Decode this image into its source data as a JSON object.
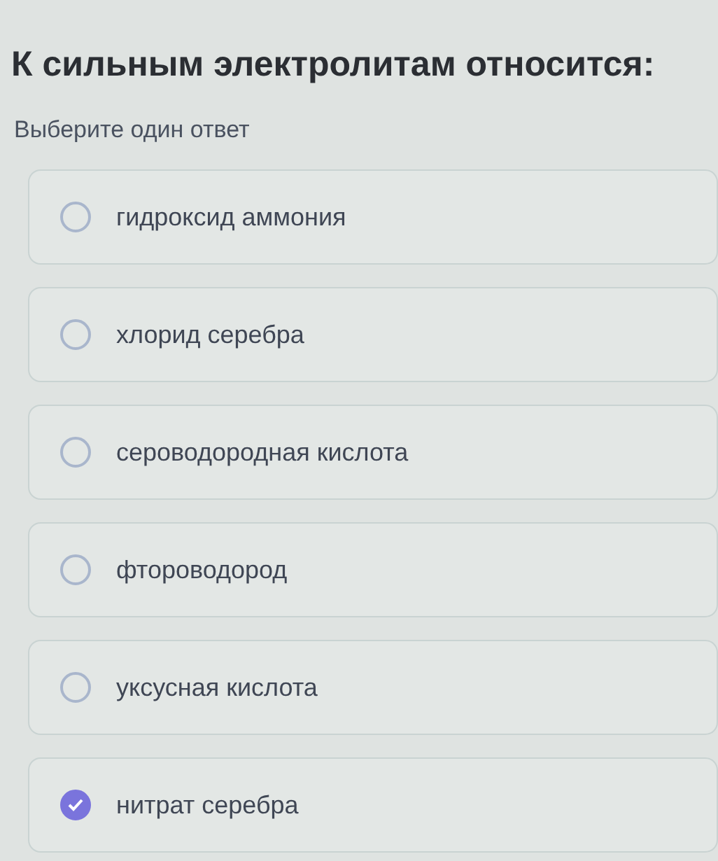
{
  "question": {
    "title": "К сильным электролитам относится:",
    "hint": "Выберите один ответ"
  },
  "options": [
    {
      "label": "гидроксид аммония",
      "selected": false
    },
    {
      "label": "хлорид серебра",
      "selected": false
    },
    {
      "label": "сероводородная кислота",
      "selected": false
    },
    {
      "label": "фтороводород",
      "selected": false
    },
    {
      "label": "уксусная кислота",
      "selected": false
    },
    {
      "label": "нитрат серебра",
      "selected": true
    }
  ]
}
